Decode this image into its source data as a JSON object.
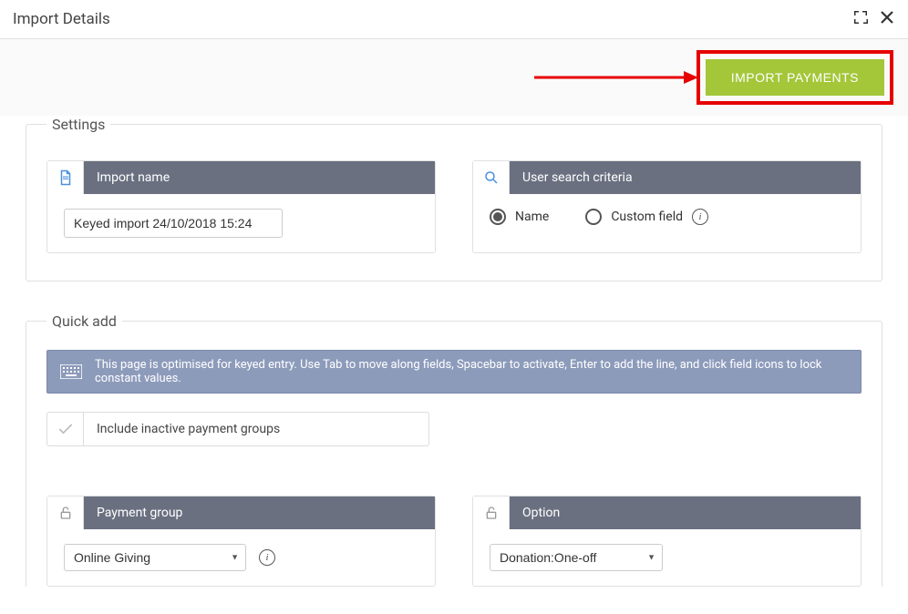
{
  "header": {
    "title": "Import Details"
  },
  "action": {
    "import_button": "IMPORT PAYMENTS"
  },
  "settings": {
    "legend": "Settings",
    "import_name": {
      "header": "Import name",
      "value": "Keyed import 24/10/2018 15:24"
    },
    "user_search": {
      "header": "User search criteria",
      "option_name": "Name",
      "option_custom": "Custom field"
    }
  },
  "quickadd": {
    "legend": "Quick add",
    "hint": "This page is optimised for keyed entry. Use Tab to move along fields, Spacebar to activate, Enter to add the line, and click field icons to lock constant values.",
    "include_inactive": "Include inactive payment groups",
    "payment_group": {
      "header": "Payment group",
      "selected": "Online Giving"
    },
    "option": {
      "header": "Option",
      "selected": "Donation:One-off"
    }
  }
}
